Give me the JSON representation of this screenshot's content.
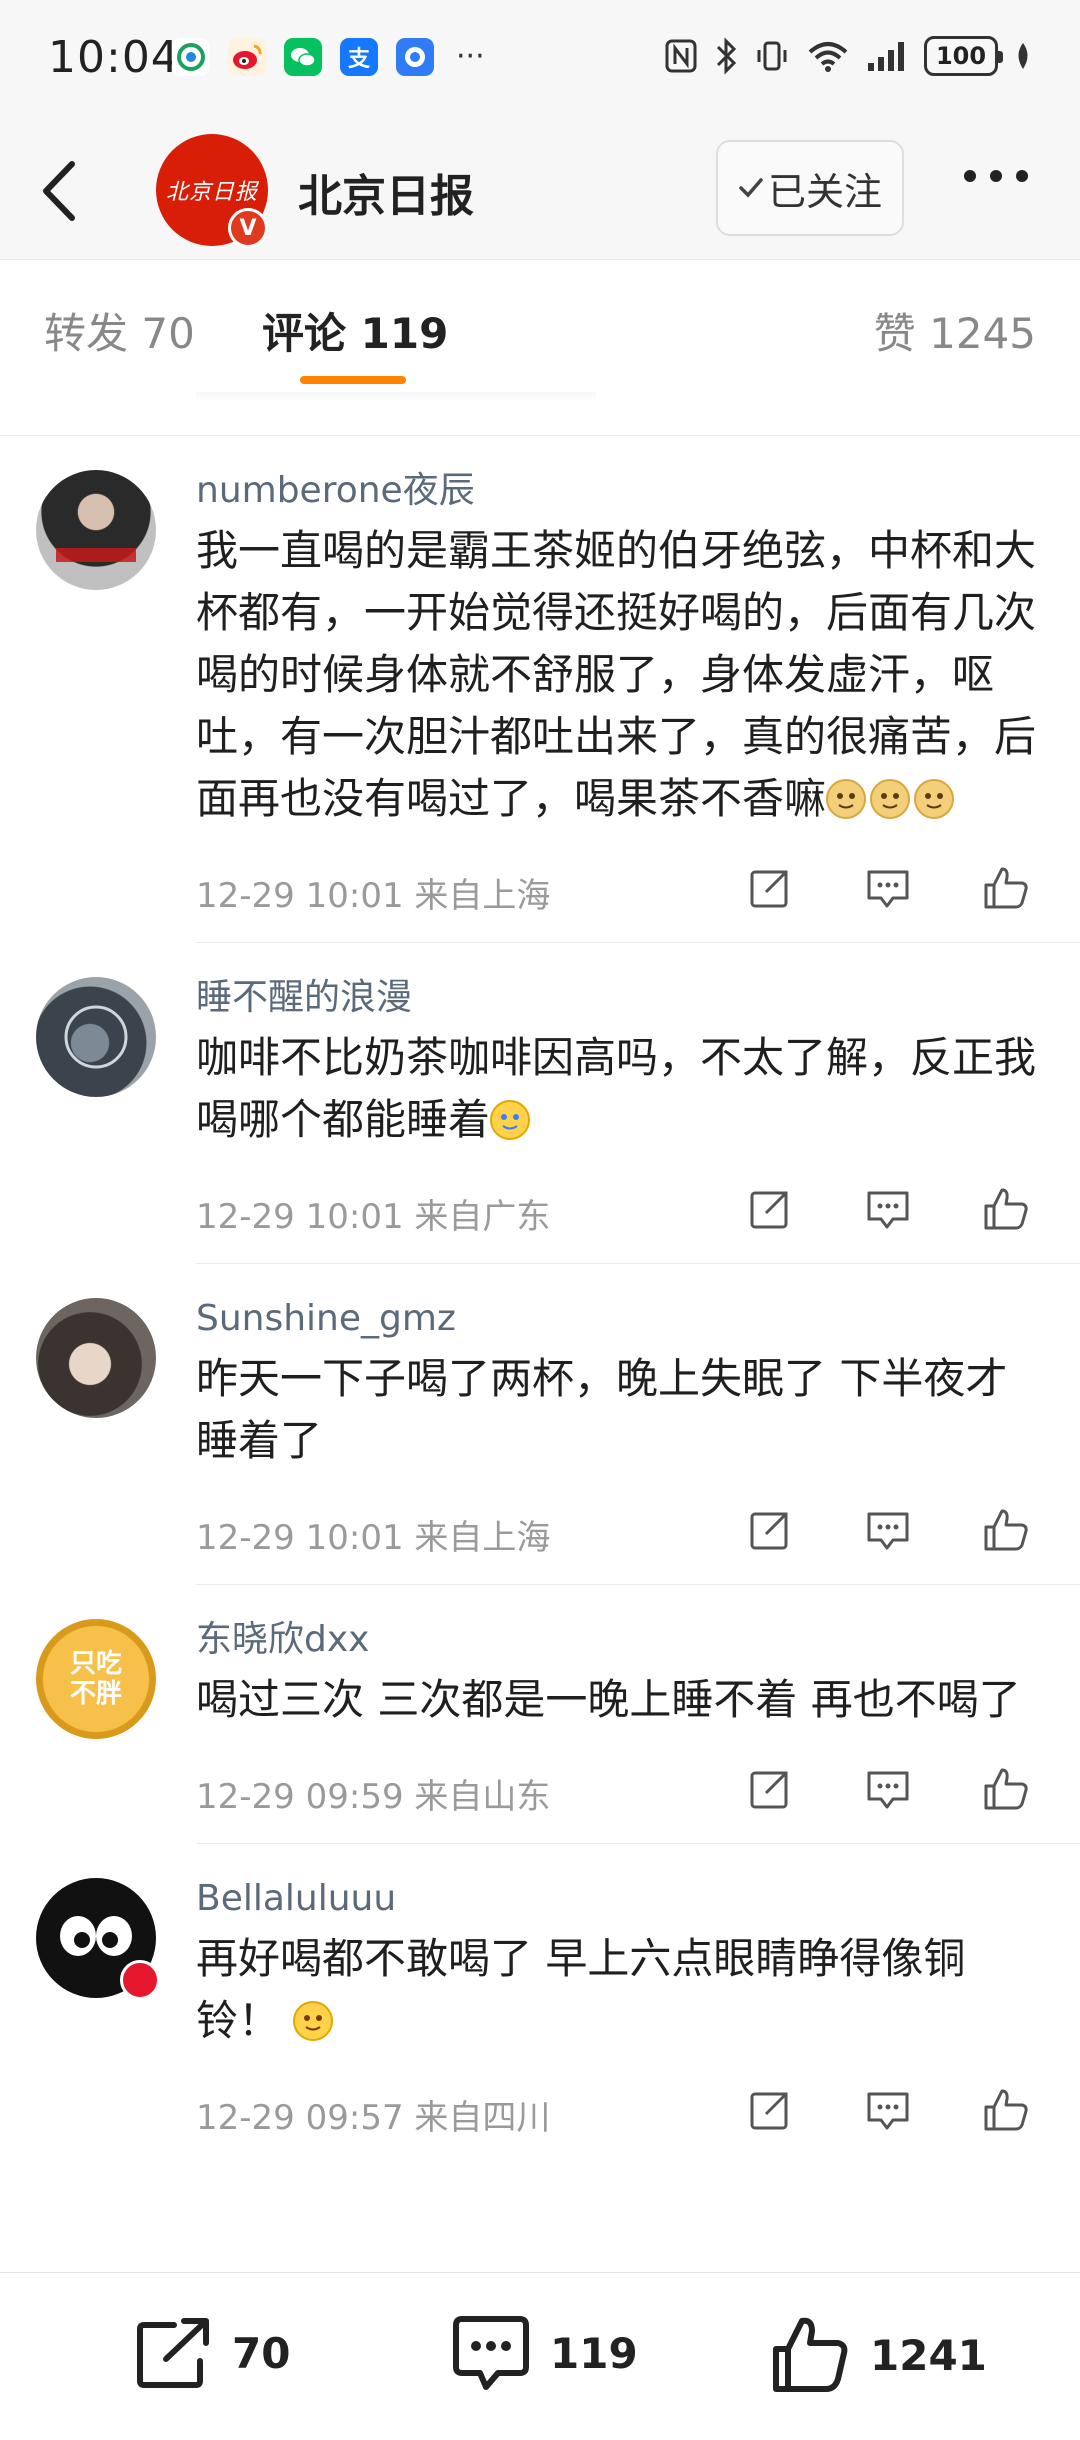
{
  "status_bar": {
    "time": "10:04",
    "more": "···",
    "battery": "100",
    "apps": [
      {
        "icon": "mobile-carrier-icon",
        "color": "#1aa260"
      },
      {
        "icon": "weibo-icon",
        "color": "#f5a623"
      },
      {
        "icon": "wechat-icon",
        "color": "#07c160"
      },
      {
        "icon": "alipay-icon",
        "color": "#1677ff",
        "label": "支"
      },
      {
        "icon": "browser-icon",
        "color": "#2f7cf6"
      }
    ]
  },
  "header": {
    "title": "北京日报",
    "logo_text": "北京日报",
    "verified_mark": "V",
    "follow_label": "已关注",
    "accent": "#d81e06"
  },
  "tabs": {
    "repost": "转发 70",
    "comments": "评论 119",
    "likes": "赞 1245",
    "active_color": "#ff8200"
  },
  "comments": [
    {
      "user": "numberone夜辰",
      "text": "我一直喝的是霸王茶姬的伯牙绝弦，中杯和大杯都有，一开始觉得还挺好喝的，后面有几次喝的时候身体就不舒服了，身体发虚汗，呕吐，有一次胆汁都吐出来了，真的很痛苦，后面再也没有喝过了，喝果茶不香嘛",
      "emoji_count": 3,
      "emoji": "doge-emoji",
      "time": "12-29 10:01",
      "location": "来自上海"
    },
    {
      "user": "睡不醒的浪漫",
      "text": "咖啡不比奶茶咖啡因高吗，不太了解，反正我喝哪个都能睡着",
      "emoji_count": 1,
      "emoji": "crying-emoji",
      "time": "12-29 10:01",
      "location": "来自广东"
    },
    {
      "user": "Sunshine_gmz",
      "text": "昨天一下子喝了两杯，晚上失眠了 下半夜才睡着了",
      "emoji_count": 0,
      "time": "12-29 10:01",
      "location": "来自上海"
    },
    {
      "user": "东晓欣dxx",
      "text": "喝过三次 三次都是一晚上睡不着 再也不喝了",
      "avatar_text": "只吃不胖",
      "emoji_count": 0,
      "time": "12-29 09:59",
      "location": "来自山东"
    },
    {
      "user": "Bellaluluuu",
      "text": "再好喝都不敢喝了 早上六点眼睛睁得像铜铃！",
      "emoji_count": 1,
      "emoji": "tongue-emoji",
      "time": "12-29 09:57",
      "location": "来自四川"
    }
  ],
  "bottom_bar": {
    "reposts": "70",
    "comments": "119",
    "likes": "1241"
  }
}
